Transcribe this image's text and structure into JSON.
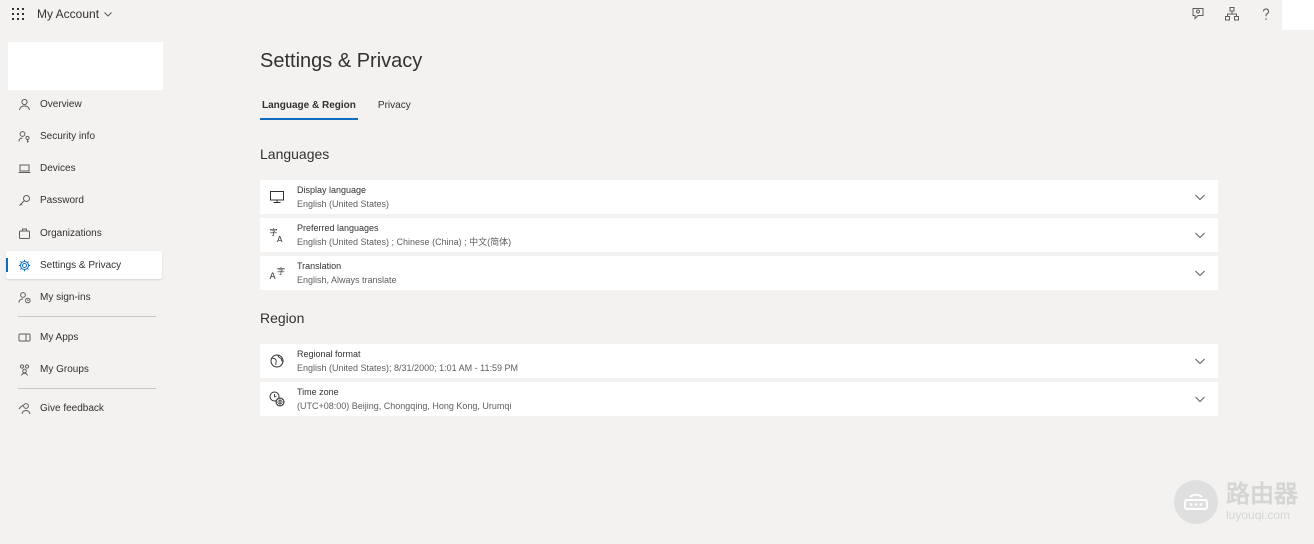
{
  "header": {
    "app_title": "My Account"
  },
  "sidebar": {
    "items": [
      {
        "label": "Overview",
        "icon": "person-icon"
      },
      {
        "label": "Security info",
        "icon": "key-person-icon"
      },
      {
        "label": "Devices",
        "icon": "laptop-icon"
      },
      {
        "label": "Password",
        "icon": "key-icon"
      },
      {
        "label": "Organizations",
        "icon": "briefcase-icon"
      },
      {
        "label": "Settings & Privacy",
        "icon": "gear-icon",
        "active": true
      },
      {
        "label": "My sign-ins",
        "icon": "person-sign-in-icon"
      },
      {
        "label": "My Apps",
        "icon": "apps-icon"
      },
      {
        "label": "My Groups",
        "icon": "groups-icon"
      },
      {
        "label": "Give feedback",
        "icon": "feedback-icon"
      }
    ]
  },
  "main": {
    "title": "Settings & Privacy",
    "tabs": [
      {
        "label": "Language & Region",
        "active": true
      },
      {
        "label": "Privacy",
        "active": false
      }
    ],
    "sections": {
      "languages": {
        "title": "Languages",
        "rows": [
          {
            "label": "Display language",
            "value": "English (United States)",
            "icon": "monitor-icon"
          },
          {
            "label": "Preferred languages",
            "value": "English (United States) ; Chinese (China) ; 中文(简体)",
            "icon": "language-icon"
          },
          {
            "label": "Translation",
            "value": "English, Always translate",
            "icon": "translate-icon"
          }
        ]
      },
      "region": {
        "title": "Region",
        "rows": [
          {
            "label": "Regional format",
            "value": "English (United States); 8/31/2000; 1:01 AM - 11:59 PM",
            "icon": "globe-icon"
          },
          {
            "label": "Time zone",
            "value": "(UTC+08:00) Beijing, Chongqing, Hong Kong, Urumqi",
            "icon": "clock-globe-icon"
          }
        ]
      }
    }
  },
  "watermark": {
    "cn": "路由器",
    "en": "luyouqi.com"
  },
  "colors": {
    "accent": "#0f6cbd",
    "background": "#f3f2f1",
    "card": "#ffffff"
  }
}
